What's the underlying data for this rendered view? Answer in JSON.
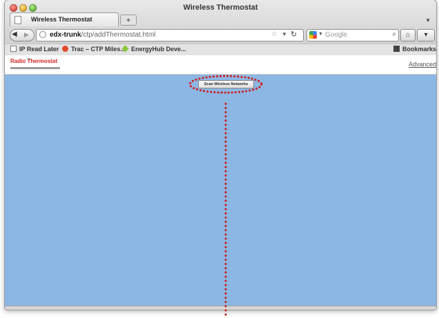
{
  "window": {
    "title": "Wireless Thermostat"
  },
  "tabs": [
    {
      "label": "Wireless Thermostat"
    }
  ],
  "new_tab_label": "+",
  "url": {
    "host": "edx-trunk",
    "path": "/ctp/addThermostat.html"
  },
  "search": {
    "placeholder": "Google"
  },
  "bookmarks": [
    {
      "label": "IP Read Later"
    },
    {
      "label": "Trac – CTP Miles..."
    },
    {
      "label": "EnergyHub Deve..."
    }
  ],
  "bookmarks_menu_label": "Bookmarks",
  "site": {
    "logo_text": "Radio Thermostat",
    "advanced_link": "Advanced",
    "scan_button": "Scan Wireless Networks"
  },
  "colors": {
    "content_bg": "#8cb6e3",
    "annotation": "#d11a1a",
    "logo_red": "#d62020"
  }
}
